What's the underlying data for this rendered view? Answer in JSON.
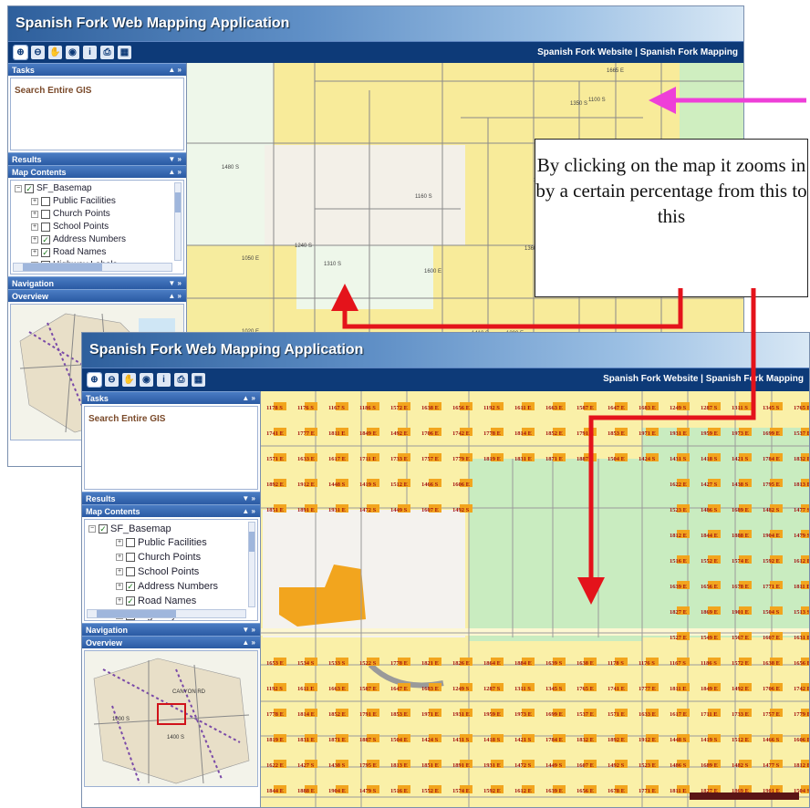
{
  "app": {
    "title": "Spanish Fork Web Mapping Application",
    "links_front": "Spanish Fork Website | Spanish Fork Mapping",
    "links_back": "Spanish Fork Website | Spanish Fork Mapping"
  },
  "tools": [
    {
      "name": "zoom-in-icon",
      "glyph": "⊕"
    },
    {
      "name": "zoom-out-icon",
      "glyph": "⊖"
    },
    {
      "name": "pan-icon",
      "glyph": "✋"
    },
    {
      "name": "full-extent-icon",
      "glyph": "◉"
    },
    {
      "name": "identify-icon",
      "glyph": "i"
    },
    {
      "name": "print-icon",
      "glyph": "⎙"
    },
    {
      "name": "map-icon",
      "glyph": "▦"
    }
  ],
  "panels": {
    "tasks": "Tasks",
    "task_item": "Search Entire GIS",
    "results": "Results",
    "map_contents": "Map Contents",
    "navigation": "Navigation",
    "overview": "Overview"
  },
  "layers": {
    "root": "SF_Basemap",
    "items": [
      "Public Facilities",
      "Church Points",
      "School Points",
      "Address Numbers",
      "Road Names",
      "Highway Labels"
    ],
    "checked": [
      false,
      false,
      false,
      true,
      true,
      false
    ]
  },
  "callout": {
    "text": "By clicking on the map it zooms in by a certain percentage from this to this"
  },
  "labels_back": [
    "1665 E",
    "1100 S",
    "1160 S",
    "1240 S",
    "1310 S",
    "1350 S",
    "1410 S",
    "1480 S",
    "1020 E",
    "1050 E",
    "1580 E",
    "1360 E",
    "1390 E",
    "1270 E",
    "2250 E",
    "1410 E",
    "1300 E",
    "1510 E",
    "1440 E",
    "1600 E"
  ],
  "labels_front": [
    "1178 S",
    "1176 S",
    "1167 S",
    "1186 S",
    "1572 E",
    "1638 E",
    "1656 E",
    "1192 S",
    "1611 E",
    "1663 E",
    "1587 E",
    "1647 E",
    "1683 E",
    "1249 S",
    "1287 S",
    "1311 S",
    "1345 S",
    "1765 E",
    "1741 E",
    "1777 E",
    "1811 E",
    "1849 E",
    "1492 E",
    "1706 E",
    "1742 E",
    "1778 E",
    "1814 E",
    "1852 E",
    "1791 E",
    "1853 E",
    "1971 E",
    "1931 E",
    "1959 E",
    "1973 E",
    "1699 E",
    "1537 E",
    "1571 E",
    "1633 E",
    "1617 E",
    "1711 E",
    "1733 E",
    "1757 E",
    "1779 E",
    "1819 E",
    "1831 E",
    "1871 E",
    "1887 S",
    "1504 E",
    "1424 S",
    "1431 S",
    "1418 S",
    "1421 S",
    "1784 E",
    "1832 E",
    "1892 E",
    "1912 E",
    "1448 S",
    "1419 S",
    "1512 E",
    "1466 S",
    "1606 E",
    "1622 E",
    "1427 S",
    "1438 S",
    "1795 E",
    "1813 E",
    "1851 E",
    "1891 E",
    "1931 E",
    "1472 S",
    "1449 S",
    "1607 E",
    "1492 S",
    "1523 E",
    "1486 S",
    "1689 E",
    "1482 S",
    "1477 S",
    "1812 E",
    "1844 E",
    "1888 E",
    "1904 E",
    "1479 S",
    "1516 E",
    "1552 E",
    "1574 E",
    "1592 E",
    "1612 E",
    "1639 E",
    "1656 E",
    "1678 E",
    "1771 E",
    "1811 E",
    "1827 E",
    "1869 E",
    "1901 E",
    "1504 S",
    "1513 S",
    "1527 E",
    "1549 E",
    "1567 E",
    "1607 E",
    "1631 E",
    "1653 E",
    "1534 S",
    "1533 S",
    "1522 S",
    "1778 E",
    "1821 E",
    "1826 E",
    "1864 E",
    "1884 E",
    "1639 S",
    "1638 E"
  ],
  "overview_labels": [
    "CANYON RD",
    "1000 S",
    "1400 S"
  ]
}
